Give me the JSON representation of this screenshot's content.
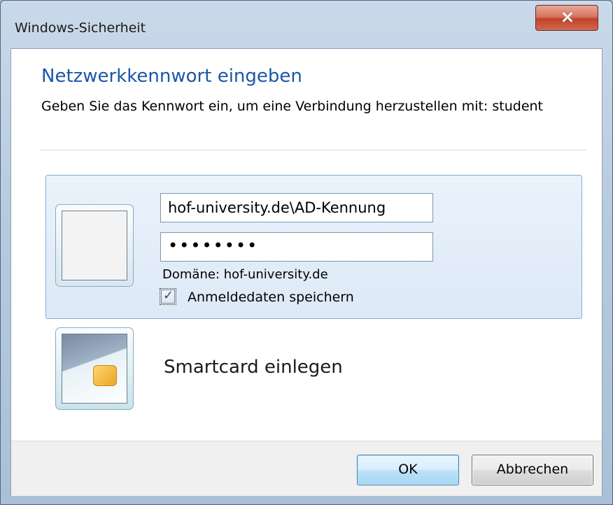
{
  "window": {
    "title": "Windows-Sicherheit"
  },
  "dialog": {
    "heading": "Netzwerkkennwort eingeben",
    "instruction": "Geben Sie das Kennwort ein, um eine Verbindung herzustellen mit: student"
  },
  "credential": {
    "username_value": "hof-university.de\\AD-Kennung",
    "password_masked": "••••••••",
    "domain_text": "Domäne: hof-university.de",
    "remember_label": "Anmeldedaten speichern",
    "remember_checked": true
  },
  "smartcard": {
    "label": "Smartcard einlegen"
  },
  "buttons": {
    "ok": "OK",
    "cancel": "Abbrechen"
  },
  "colors": {
    "heading": "#1c56a8",
    "tile_selected": "#dde9f7",
    "close_button": "#c0432a"
  },
  "icons": {
    "close": "close-icon",
    "user_tile": "user-tile-icon",
    "smartcard": "smartcard-icon",
    "check": "checkmark-icon"
  }
}
